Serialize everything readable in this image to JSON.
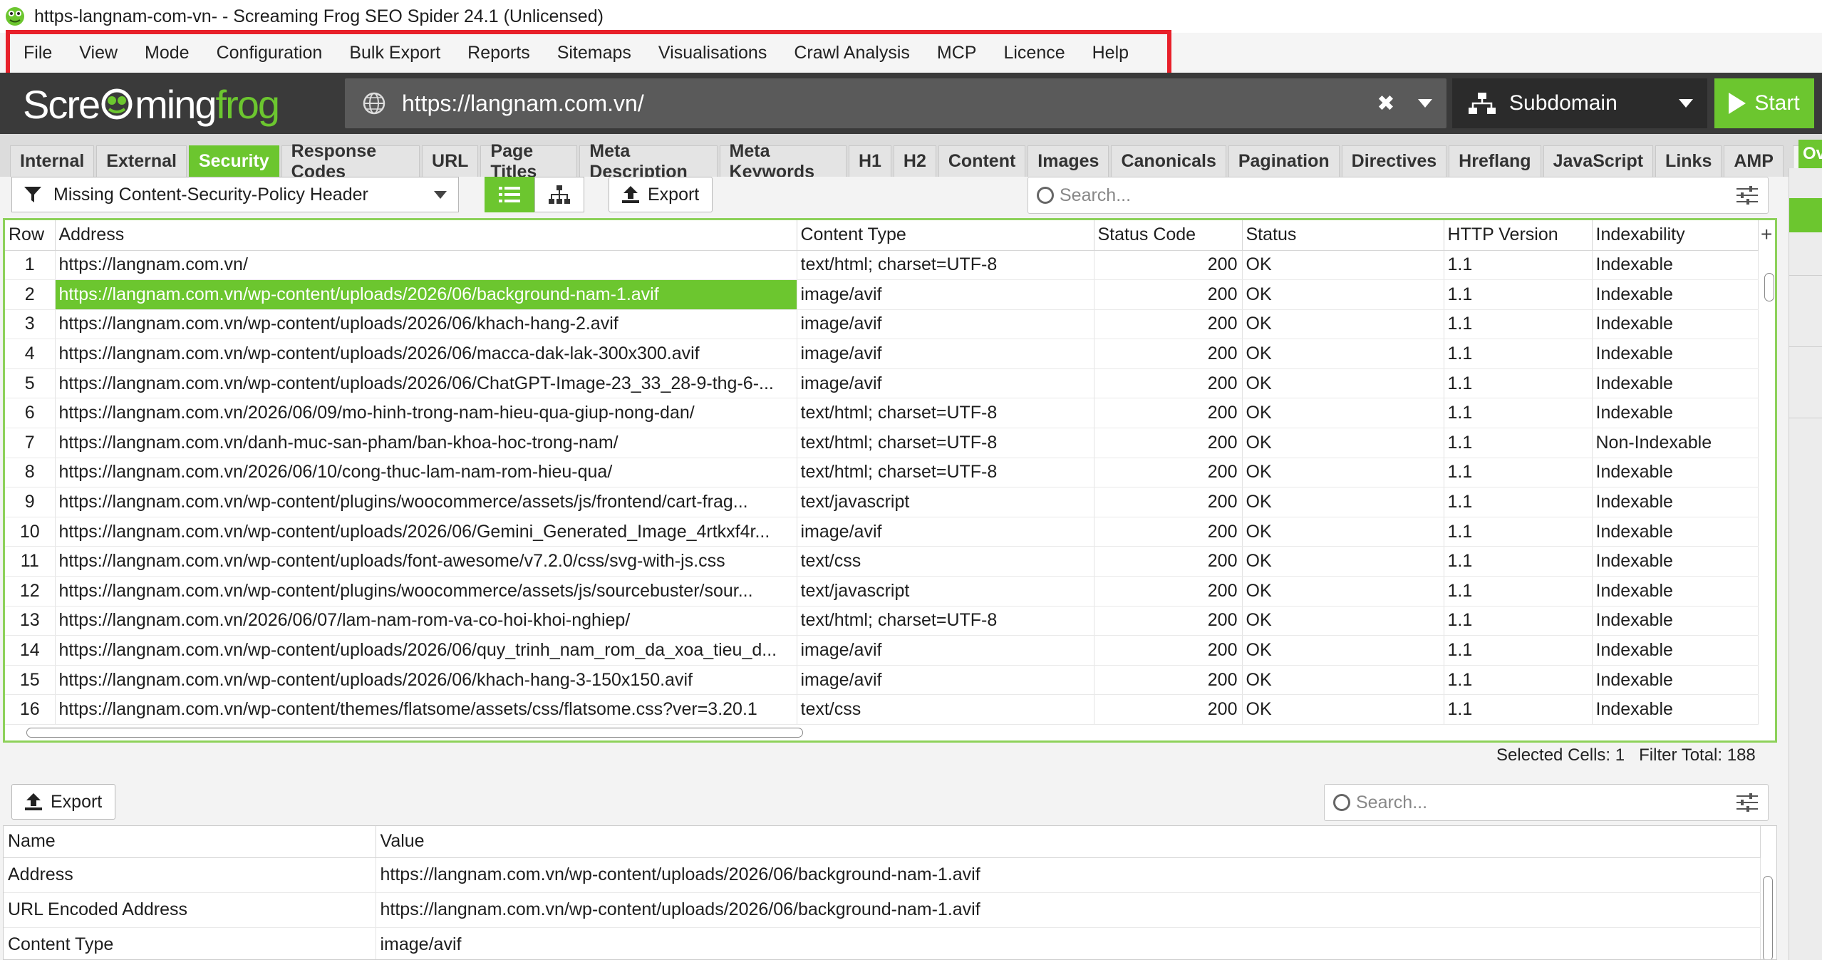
{
  "window": {
    "title": "https-langnam-com-vn- - Screaming Frog SEO Spider 24.1 (Unlicensed)"
  },
  "menu": [
    "File",
    "View",
    "Mode",
    "Configuration",
    "Bulk Export",
    "Reports",
    "Sitemaps",
    "Visualisations",
    "Crawl Analysis",
    "MCP",
    "Licence",
    "Help"
  ],
  "brand": {
    "logo_a": "Scre",
    "logo_b": "ming",
    "logo_c": "frog",
    "accent": "#6cc62f"
  },
  "urlbar": {
    "url": "https://langnam.com.vn/"
  },
  "mode": {
    "label": "Subdomain"
  },
  "start": {
    "label": "Start"
  },
  "tabs": [
    "Internal",
    "External",
    "Security",
    "Response Codes",
    "URL",
    "Page Titles",
    "Meta Description",
    "Meta Keywords",
    "H1",
    "H2",
    "Content",
    "Images",
    "Canonicals",
    "Pagination",
    "Directives",
    "Hreflang",
    "JavaScript",
    "Links",
    "AMP"
  ],
  "active_tab": "Security",
  "right_tab": "Ov",
  "filter": {
    "label": "Missing Content-Security-Policy Header"
  },
  "toolbar": {
    "export_label": "Export",
    "search_placeholder": "Search..."
  },
  "table": {
    "columns": [
      "Row",
      "Address",
      "Content Type",
      "Status Code",
      "Status",
      "HTTP Version",
      "Indexability"
    ],
    "rows": [
      [
        "1",
        "https://langnam.com.vn/",
        "text/html; charset=UTF-8",
        "200",
        "OK",
        "1.1",
        "Indexable"
      ],
      [
        "2",
        "https://langnam.com.vn/wp-content/uploads/2026/06/background-nam-1.avif",
        "image/avif",
        "200",
        "OK",
        "1.1",
        "Indexable"
      ],
      [
        "3",
        "https://langnam.com.vn/wp-content/uploads/2026/06/khach-hang-2.avif",
        "image/avif",
        "200",
        "OK",
        "1.1",
        "Indexable"
      ],
      [
        "4",
        "https://langnam.com.vn/wp-content/uploads/2026/06/macca-dak-lak-300x300.avif",
        "image/avif",
        "200",
        "OK",
        "1.1",
        "Indexable"
      ],
      [
        "5",
        "https://langnam.com.vn/wp-content/uploads/2026/06/ChatGPT-Image-23_33_28-9-thg-6-...",
        "image/avif",
        "200",
        "OK",
        "1.1",
        "Indexable"
      ],
      [
        "6",
        "https://langnam.com.vn/2026/06/09/mo-hinh-trong-nam-hieu-qua-giup-nong-dan/",
        "text/html; charset=UTF-8",
        "200",
        "OK",
        "1.1",
        "Indexable"
      ],
      [
        "7",
        "https://langnam.com.vn/danh-muc-san-pham/ban-khoa-hoc-trong-nam/",
        "text/html; charset=UTF-8",
        "200",
        "OK",
        "1.1",
        "Non-Indexable"
      ],
      [
        "8",
        "https://langnam.com.vn/2026/06/10/cong-thuc-lam-nam-rom-hieu-qua/",
        "text/html; charset=UTF-8",
        "200",
        "OK",
        "1.1",
        "Indexable"
      ],
      [
        "9",
        "https://langnam.com.vn/wp-content/plugins/woocommerce/assets/js/frontend/cart-frag...",
        "text/javascript",
        "200",
        "OK",
        "1.1",
        "Indexable"
      ],
      [
        "10",
        "https://langnam.com.vn/wp-content/uploads/2026/06/Gemini_Generated_Image_4rtkxf4r...",
        "image/avif",
        "200",
        "OK",
        "1.1",
        "Indexable"
      ],
      [
        "11",
        "https://langnam.com.vn/wp-content/uploads/font-awesome/v7.2.0/css/svg-with-js.css",
        "text/css",
        "200",
        "OK",
        "1.1",
        "Indexable"
      ],
      [
        "12",
        "https://langnam.com.vn/wp-content/plugins/woocommerce/assets/js/sourcebuster/sour...",
        "text/javascript",
        "200",
        "OK",
        "1.1",
        "Indexable"
      ],
      [
        "13",
        "https://langnam.com.vn/2026/06/07/lam-nam-rom-va-co-hoi-khoi-nghiep/",
        "text/html; charset=UTF-8",
        "200",
        "OK",
        "1.1",
        "Indexable"
      ],
      [
        "14",
        "https://langnam.com.vn/wp-content/uploads/2026/06/quy_trinh_nam_rom_da_xoa_tieu_d...",
        "image/avif",
        "200",
        "OK",
        "1.1",
        "Indexable"
      ],
      [
        "15",
        "https://langnam.com.vn/wp-content/uploads/2026/06/khach-hang-3-150x150.avif",
        "image/avif",
        "200",
        "OK",
        "1.1",
        "Indexable"
      ],
      [
        "16",
        "https://langnam.com.vn/wp-content/themes/flatsome/assets/css/flatsome.css?ver=3.20.1",
        "text/css",
        "200",
        "OK",
        "1.1",
        "Indexable"
      ]
    ],
    "selected_row": 1
  },
  "status": {
    "selected_label": "Selected Cells:",
    "selected_value": "1",
    "filter_label": "Filter Total:",
    "filter_value": "188"
  },
  "details": {
    "export_label": "Export",
    "search_placeholder": "Search...",
    "columns": [
      "Name",
      "Value"
    ],
    "rows": [
      [
        "Address",
        "https://langnam.com.vn/wp-content/uploads/2026/06/background-nam-1.avif"
      ],
      [
        "URL Encoded Address",
        "https://langnam.com.vn/wp-content/uploads/2026/06/background-nam-1.avif"
      ],
      [
        "Content Type",
        "image/avif"
      ]
    ]
  }
}
